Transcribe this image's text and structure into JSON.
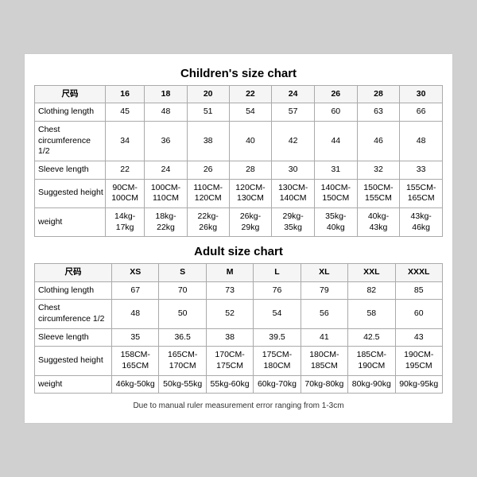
{
  "children_title": "Children's size chart",
  "adult_title": "Adult size chart",
  "note": "Due to manual ruler measurement error ranging from 1-3cm",
  "children_table": {
    "headers": [
      "尺码",
      "16",
      "18",
      "20",
      "22",
      "24",
      "26",
      "28",
      "30"
    ],
    "rows": [
      {
        "label": "Clothing length",
        "values": [
          "45",
          "48",
          "51",
          "54",
          "57",
          "60",
          "63",
          "66"
        ]
      },
      {
        "label": "Chest circumference 1/2",
        "values": [
          "34",
          "36",
          "38",
          "40",
          "42",
          "44",
          "46",
          "48"
        ]
      },
      {
        "label": "Sleeve length",
        "values": [
          "22",
          "24",
          "26",
          "28",
          "30",
          "31",
          "32",
          "33"
        ]
      },
      {
        "label": "Suggested height",
        "values": [
          "90CM-100CM",
          "100CM-110CM",
          "110CM-120CM",
          "120CM-130CM",
          "130CM-140CM",
          "140CM-150CM",
          "150CM-155CM",
          "155CM-165CM"
        ]
      },
      {
        "label": "weight",
        "values": [
          "14kg-17kg",
          "18kg-22kg",
          "22kg-26kg",
          "26kg-29kg",
          "29kg-35kg",
          "35kg-40kg",
          "40kg-43kg",
          "43kg-46kg"
        ]
      }
    ]
  },
  "adult_table": {
    "headers": [
      "尺码",
      "XS",
      "S",
      "M",
      "L",
      "XL",
      "XXL",
      "XXXL"
    ],
    "rows": [
      {
        "label": "Clothing length",
        "values": [
          "67",
          "70",
          "73",
          "76",
          "79",
          "82",
          "85"
        ]
      },
      {
        "label": "Chest circumference 1/2",
        "values": [
          "48",
          "50",
          "52",
          "54",
          "56",
          "58",
          "60"
        ]
      },
      {
        "label": "Sleeve length",
        "values": [
          "35",
          "36.5",
          "38",
          "39.5",
          "41",
          "42.5",
          "43"
        ]
      },
      {
        "label": "Suggested height",
        "values": [
          "158CM-165CM",
          "165CM-170CM",
          "170CM-175CM",
          "175CM-180CM",
          "180CM-185CM",
          "185CM-190CM",
          "190CM-195CM"
        ]
      },
      {
        "label": "weight",
        "values": [
          "46kg-50kg",
          "50kg-55kg",
          "55kg-60kg",
          "60kg-70kg",
          "70kg-80kg",
          "80kg-90kg",
          "90kg-95kg"
        ]
      }
    ]
  }
}
